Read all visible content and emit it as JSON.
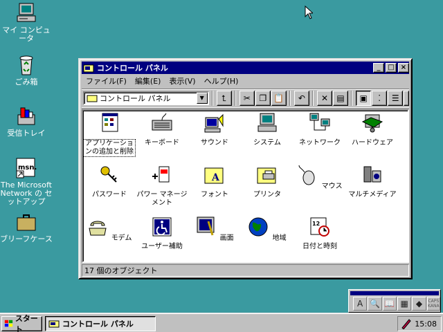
{
  "desktop": {
    "icons": [
      {
        "name": "my-computer",
        "label": "マイ コンピュータ",
        "icon": "computer-icon"
      },
      {
        "name": "recycle-bin",
        "label": "ごみ箱",
        "icon": "recycle-bin-icon"
      },
      {
        "name": "inbox",
        "label": "受信トレイ",
        "icon": "inbox-icon"
      },
      {
        "name": "msn",
        "label": "The Microsoft Network の セットアップ",
        "icon": "msn-icon"
      },
      {
        "name": "briefcase",
        "label": "ブリーフケース",
        "icon": "briefcase-icon"
      }
    ]
  },
  "window": {
    "title": "コントロール パネル",
    "buttons": {
      "minimize": "_",
      "maximize": "□",
      "close": "×"
    },
    "menu": [
      "ファイル(F)",
      "編集(E)",
      "表示(V)",
      "ヘルプ(H)"
    ],
    "address": "コントロール パネル",
    "items": [
      {
        "label": "アプリケーションの追加と削除",
        "icon": "add-remove-programs-icon",
        "selected": true
      },
      {
        "label": "キーボード",
        "icon": "keyboard-icon"
      },
      {
        "label": "サウンド",
        "icon": "sound-icon"
      },
      {
        "label": "システム",
        "icon": "system-icon"
      },
      {
        "label": "ネットワーク",
        "icon": "network-icon"
      },
      {
        "label": "ハードウェア",
        "icon": "hardware-icon"
      },
      {
        "label": "パスワード",
        "icon": "password-icon"
      },
      {
        "label": "パワー マネージメント",
        "icon": "power-management-icon"
      },
      {
        "label": "フォント",
        "icon": "fonts-icon"
      },
      {
        "label": "プリンタ",
        "icon": "printers-icon"
      },
      {
        "label": "マウス",
        "icon": "mouse-icon"
      },
      {
        "label": "マルチメディア",
        "icon": "multimedia-icon"
      },
      {
        "label": "モデム",
        "icon": "modem-icon"
      },
      {
        "label": "ユーザー補助",
        "icon": "accessibility-icon"
      },
      {
        "label": "画面",
        "icon": "display-icon"
      },
      {
        "label": "地域",
        "icon": "regional-icon"
      },
      {
        "label": "日付と時刻",
        "icon": "date-time-icon"
      }
    ],
    "status": "17 個のオブジェクト"
  },
  "ime": {
    "mode": "A",
    "caps_top": "CAPS",
    "caps_bottom": "KANA"
  },
  "taskbar": {
    "start_label": "スタート",
    "task_label": "コントロール パネル",
    "clock": "15:08"
  },
  "colors": {
    "desktop": "#3a9aa0",
    "title_active": "#000080",
    "face": "#c0c0c0"
  }
}
